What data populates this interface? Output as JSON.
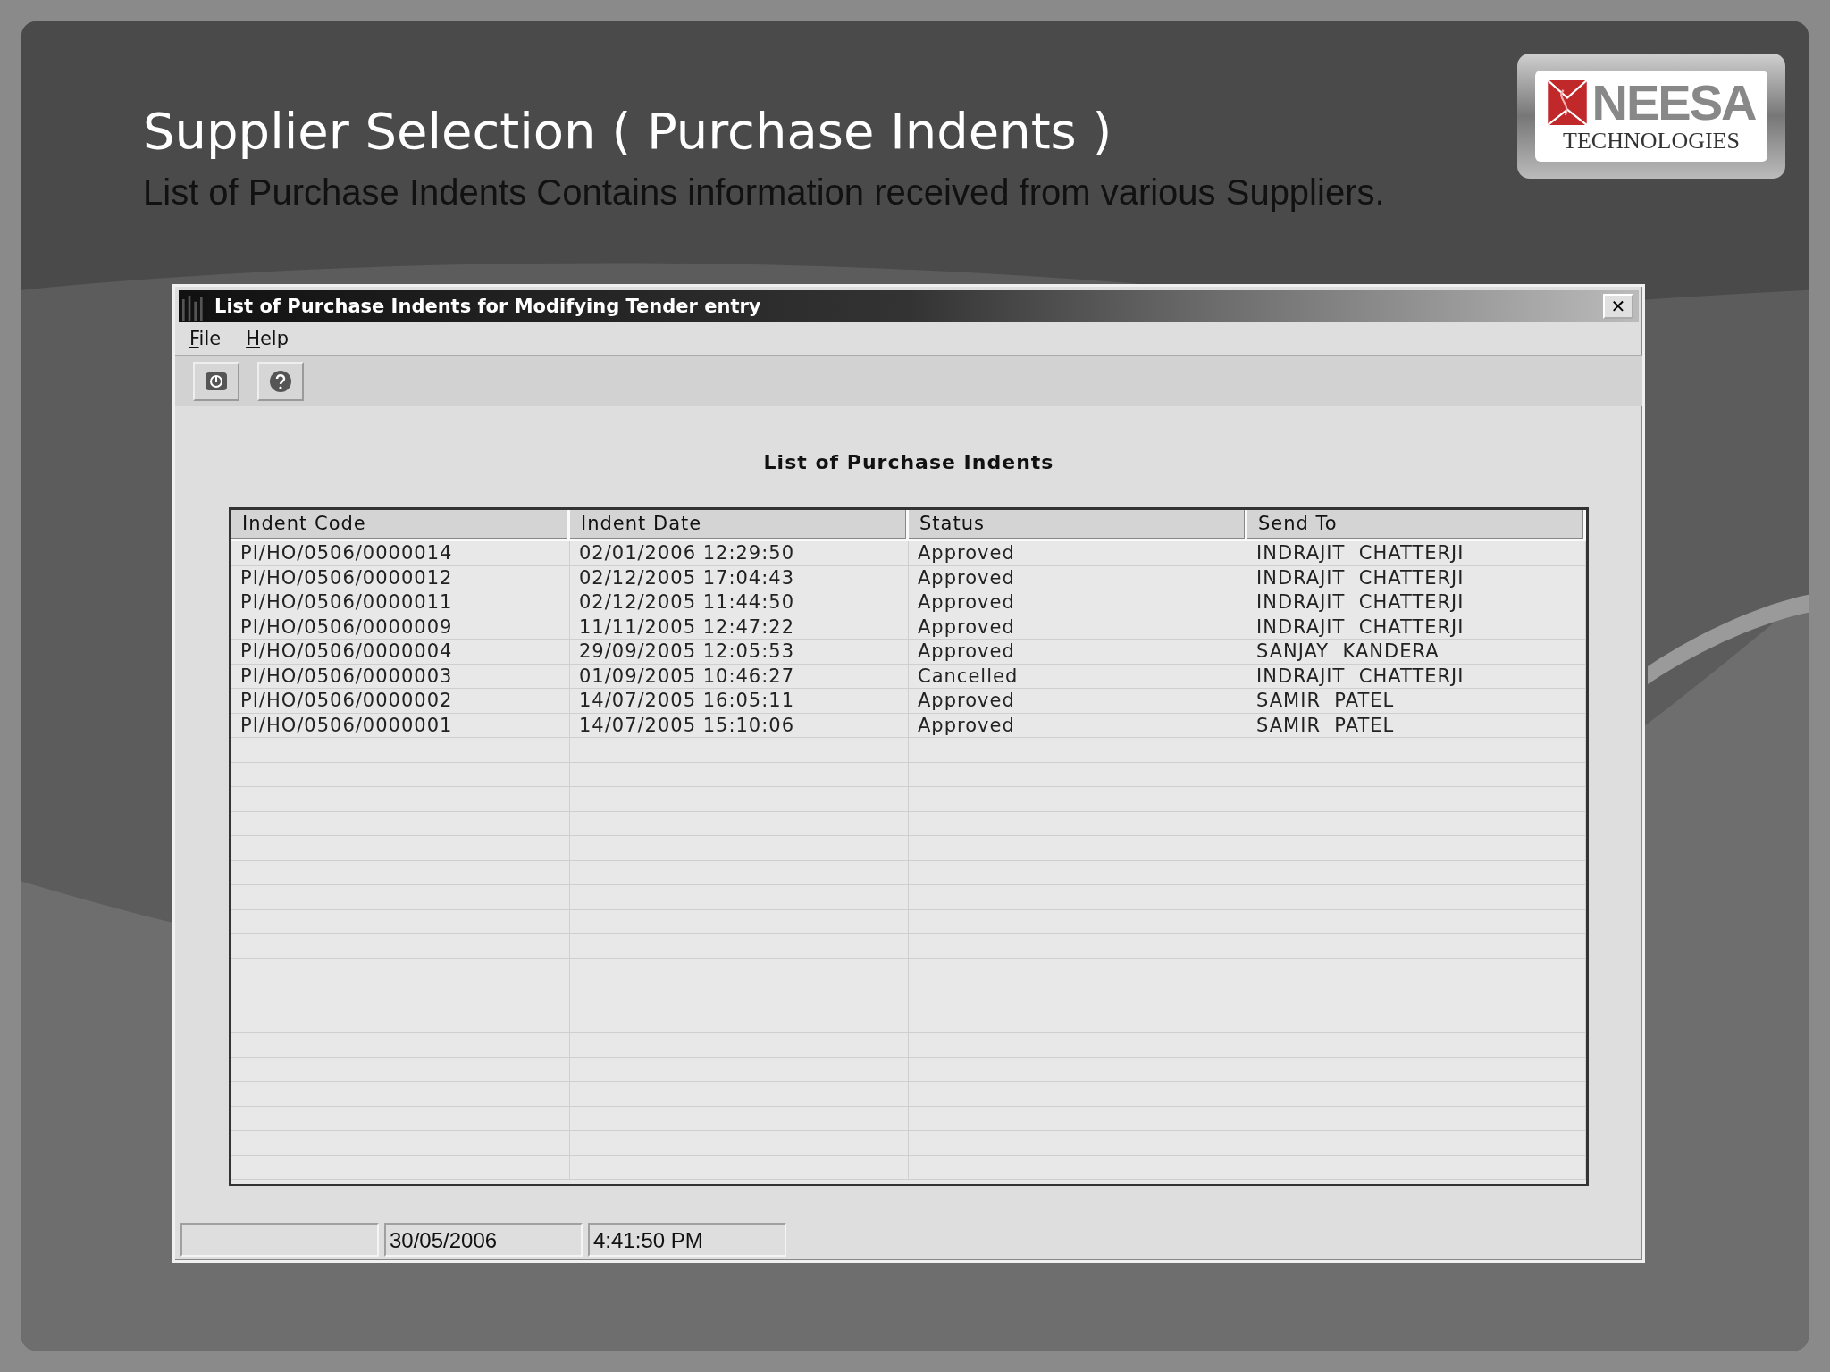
{
  "slide": {
    "title": "Supplier Selection ( Purchase Indents )",
    "subtitle": "List of Purchase Indents Contains information received from various Suppliers."
  },
  "logo": {
    "name": "NEESA",
    "tagline": "TECHNOLOGIES"
  },
  "window": {
    "title": "List of Purchase Indents for Modifying Tender entry",
    "close": "✕"
  },
  "menu": [
    "File",
    "Help"
  ],
  "heading": "List of Purchase Indents",
  "table": {
    "columns": [
      "Indent Code",
      "Indent Date",
      "Status",
      "Send To"
    ],
    "rows": [
      [
        "PI/HO/0506/0000014",
        "02/01/2006 12:29:50",
        "Approved",
        "INDRAJIT  CHATTERJI"
      ],
      [
        "PI/HO/0506/0000012",
        "02/12/2005 17:04:43",
        "Approved",
        "INDRAJIT  CHATTERJI"
      ],
      [
        "PI/HO/0506/0000011",
        "02/12/2005 11:44:50",
        "Approved",
        "INDRAJIT  CHATTERJI"
      ],
      [
        "PI/HO/0506/0000009",
        "11/11/2005 12:47:22",
        "Approved",
        "INDRAJIT  CHATTERJI"
      ],
      [
        "PI/HO/0506/0000004",
        "29/09/2005 12:05:53",
        "Approved",
        "SANJAY  KANDERA"
      ],
      [
        "PI/HO/0506/0000003",
        "01/09/2005 10:46:27",
        "Cancelled",
        "INDRAJIT  CHATTERJI"
      ],
      [
        "PI/HO/0506/0000002",
        "14/07/2005 16:05:11",
        "Approved",
        "SAMIR  PATEL"
      ],
      [
        "PI/HO/0506/0000001",
        "14/07/2005 15:10:06",
        "Approved",
        "SAMIR  PATEL"
      ]
    ]
  },
  "status_bar": {
    "date": "30/05/2006",
    "time": "4:41:50 PM"
  }
}
